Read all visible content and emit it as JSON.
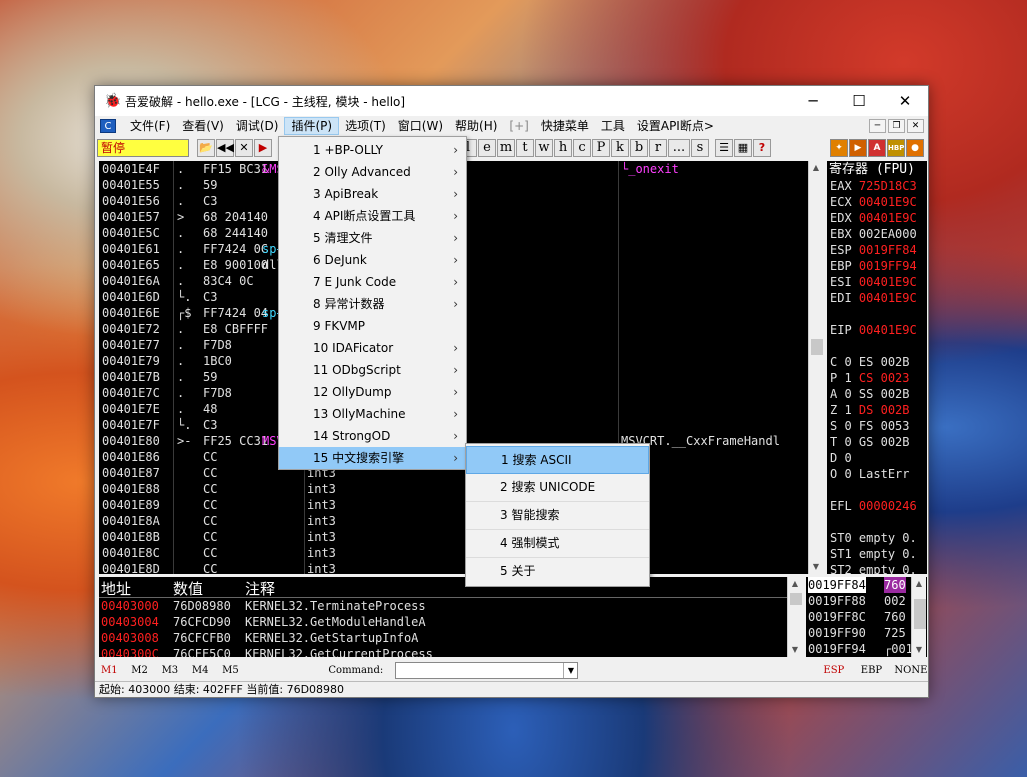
{
  "window": {
    "title": "吾爱破解 - hello.exe - [LCG - 主线程, 模块 - hello]",
    "app_icon": "bug-icon",
    "min": "─",
    "max": "☐",
    "close": "✕"
  },
  "menubar": {
    "items": [
      {
        "label": "文件(F)"
      },
      {
        "label": "查看(V)"
      },
      {
        "label": "调试(D)"
      },
      {
        "label": "插件(P)",
        "active": true
      },
      {
        "label": "选项(T)"
      },
      {
        "label": "窗口(W)"
      },
      {
        "label": "帮助(H)"
      },
      {
        "label": "[+]",
        "dim": true
      },
      {
        "label": "快捷菜单"
      },
      {
        "label": "工具"
      },
      {
        "label": "设置API断点>"
      }
    ]
  },
  "toolbar": {
    "status": "暂停",
    "letters": [
      "l",
      "e",
      "m",
      "t",
      "w",
      "h",
      "c",
      "P",
      "k",
      "b",
      "r",
      "...",
      "s"
    ],
    "right_icons": [
      "bug-icon",
      "run-icon",
      "abp-icon",
      "hbp-icon",
      "bp-icon"
    ]
  },
  "plugin_menu": {
    "items": [
      {
        "label": "1 +BP-OLLY",
        "sub": true
      },
      {
        "label": "2 Olly Advanced",
        "sub": true
      },
      {
        "label": "3 ApiBreak",
        "sub": true
      },
      {
        "label": "4 API断点设置工具",
        "sub": true
      },
      {
        "label": "5 清理文件",
        "sub": true
      },
      {
        "label": "6 DeJunk",
        "sub": true
      },
      {
        "label": "7 E Junk Code",
        "sub": true
      },
      {
        "label": "8 异常计数器",
        "sub": true
      },
      {
        "label": "9 FKVMP",
        "sub": false
      },
      {
        "label": "10 IDAFicator",
        "sub": true
      },
      {
        "label": "11 ODbgScript",
        "sub": true
      },
      {
        "label": "12 OllyDump",
        "sub": true
      },
      {
        "label": "13 OllyMachine",
        "sub": true
      },
      {
        "label": "14 StrongOD",
        "sub": true
      },
      {
        "label": "15 中文搜索引擎",
        "sub": true,
        "highlight": true
      }
    ]
  },
  "search_submenu": {
    "items": [
      {
        "label": "1 搜索 ASCII",
        "highlight": true
      },
      {
        "label": "2 搜索 UNICODE"
      },
      {
        "label": "3 智能搜索"
      },
      {
        "label": "4 强制模式"
      },
      {
        "label": "5 关于"
      }
    ]
  },
  "cpu": {
    "rows": [
      {
        "addr": "00401E4F",
        "mark": ".",
        "hex": "FF15 BC31",
        "dis": "",
        "cmt": "&MSVCRT._onexit>]",
        "cmt2": "└_onexit"
      },
      {
        "addr": "00401E55",
        "mark": ".",
        "hex": "59",
        "dis": "",
        "cmt": ""
      },
      {
        "addr": "00401E56",
        "mark": ".",
        "hex": "C3",
        "dis": "",
        "cmt": ""
      },
      {
        "addr": "00401E57",
        "mark": ">",
        "hex": "68 204140",
        "dis": "",
        "cmt": ""
      },
      {
        "addr": "00401E5C",
        "mark": ".",
        "hex": "68 244140",
        "dis": "",
        "cmt": ""
      },
      {
        "addr": "00401E61",
        "mark": ".",
        "hex": "FF7424 0C",
        "dis": "",
        "cmt": "sp+0xC]"
      },
      {
        "addr": "00401E65",
        "mark": ".",
        "hex": "E8 900100",
        "dis": "",
        "cmt": "dllonexit>"
      },
      {
        "addr": "00401E6A",
        "mark": ".",
        "hex": "83C4 0C",
        "dis": "",
        "cmt": ""
      },
      {
        "addr": "00401E6D",
        "mark": "└.",
        "hex": "C3",
        "dis": "",
        "cmt": ""
      },
      {
        "addr": "00401E6E",
        "mark": "┌$",
        "hex": "FF7424 04",
        "dis": "",
        "cmt": "sp+0x4]"
      },
      {
        "addr": "00401E72",
        "mark": ".",
        "hex": "E8 CBFFFF",
        "dis": "",
        "cmt": ""
      },
      {
        "addr": "00401E77",
        "mark": ".",
        "hex": "F7D8",
        "dis": "",
        "cmt": ""
      },
      {
        "addr": "00401E79",
        "mark": ".",
        "hex": "1BC0",
        "dis": "",
        "cmt": ""
      },
      {
        "addr": "00401E7B",
        "mark": ".",
        "hex": "59",
        "dis": "",
        "cmt": ""
      },
      {
        "addr": "00401E7C",
        "mark": ".",
        "hex": "F7D8",
        "dis": "",
        "cmt": ""
      },
      {
        "addr": "00401E7E",
        "mark": ".",
        "hex": "48",
        "dis": "",
        "cmt": ""
      },
      {
        "addr": "00401E7F",
        "mark": "└.",
        "hex": "C3",
        "dis": "",
        "cmt": ""
      },
      {
        "addr": "00401E80",
        "mark": ">-",
        "hex": "FF25 CC31",
        "dis": "",
        "cmt": "MSVCRT.__CxxFrameHa",
        "cmt2": "MSVCRT.__CxxFrameHandl"
      },
      {
        "addr": "00401E86",
        "mark": "",
        "hex": "CC",
        "dis": "int3",
        "cmt": ""
      },
      {
        "addr": "00401E87",
        "mark": "",
        "hex": "CC",
        "dis": "int3",
        "cmt": ""
      },
      {
        "addr": "00401E88",
        "mark": "",
        "hex": "CC",
        "dis": "int3",
        "cmt": ""
      },
      {
        "addr": "00401E89",
        "mark": "",
        "hex": "CC",
        "dis": "int3",
        "cmt": ""
      },
      {
        "addr": "00401E8A",
        "mark": "",
        "hex": "CC",
        "dis": "int3",
        "cmt": ""
      },
      {
        "addr": "00401E8B",
        "mark": "",
        "hex": "CC",
        "dis": "int3",
        "cmt": ""
      },
      {
        "addr": "00401E8C",
        "mark": "",
        "hex": "CC",
        "dis": "int3",
        "cmt": ""
      },
      {
        "addr": "00401E8D",
        "mark": "",
        "hex": "CC",
        "dis": "int3",
        "cmt": ""
      }
    ]
  },
  "registers": {
    "title": "寄存器 (FPU)",
    "rows": [
      {
        "n": "EAX",
        "v": "725D18C3",
        "red": true
      },
      {
        "n": "ECX",
        "v": "00401E9C",
        "red": true
      },
      {
        "n": "EDX",
        "v": "00401E9C",
        "red": true
      },
      {
        "n": "EBX",
        "v": "002EA000",
        "red": false
      },
      {
        "n": "ESP",
        "v": "0019FF84",
        "red": true
      },
      {
        "n": "EBP",
        "v": "0019FF94",
        "red": true
      },
      {
        "n": "ESI",
        "v": "00401E9C",
        "red": true
      },
      {
        "n": "EDI",
        "v": "00401E9C",
        "red": true
      },
      {
        "n": "",
        "v": "",
        "red": false
      },
      {
        "n": "EIP",
        "v": "00401E9C",
        "red": true
      },
      {
        "n": "",
        "v": "",
        "red": false
      },
      {
        "n": "C 0",
        "v": "ES 002B",
        "red": false
      },
      {
        "n": "P 1",
        "v": "CS 0023",
        "red": true
      },
      {
        "n": "A 0",
        "v": "SS 002B",
        "red": false
      },
      {
        "n": "Z 1",
        "v": "DS 002B",
        "red": true
      },
      {
        "n": "S 0",
        "v": "FS 0053",
        "red": false
      },
      {
        "n": "T 0",
        "v": "GS 002B",
        "red": false
      },
      {
        "n": "D 0",
        "v": "",
        "red": false
      },
      {
        "n": "O 0",
        "v": "LastErr",
        "red": false
      },
      {
        "n": "",
        "v": "",
        "red": false
      },
      {
        "n": "EFL",
        "v": "00000246",
        "red": true
      },
      {
        "n": "",
        "v": "",
        "red": false
      },
      {
        "n": "ST0",
        "v": "empty 0.",
        "red": false
      },
      {
        "n": "ST1",
        "v": "empty 0.",
        "red": false
      },
      {
        "n": "ST2",
        "v": "empty 0.",
        "red": false
      },
      {
        "n": "ST3",
        "v": "empty 0.",
        "red": false
      },
      {
        "n": "ST4",
        "v": "empty 0.",
        "red": false
      }
    ]
  },
  "dump": {
    "headers": [
      "地址",
      "数值",
      "注释"
    ],
    "rows": [
      {
        "addr": "00403000",
        "val": "76D08980",
        "cmt": "KERNEL32.TerminateProcess"
      },
      {
        "addr": "00403004",
        "val": "76CFCD90",
        "cmt": "KERNEL32.GetModuleHandleA"
      },
      {
        "addr": "00403008",
        "val": "76CFCFB0",
        "cmt": "KERNEL32.GetStartupInfoA"
      },
      {
        "addr": "0040300C",
        "val": "76CFF5C0",
        "cmt": "KERNEL32.GetCurrentProcess"
      }
    ]
  },
  "stack": {
    "rows": [
      {
        "addr": "0019FF84",
        "val": "760",
        "sel": true
      },
      {
        "addr": "0019FF88",
        "val": "002"
      },
      {
        "addr": "0019FF8C",
        "val": "760"
      },
      {
        "addr": "0019FF90",
        "val": "725"
      },
      {
        "addr": "0019FF94",
        "val": "┌001"
      }
    ]
  },
  "cmdbar": {
    "m": [
      "M1",
      "M2",
      "M3",
      "M4",
      "M5"
    ],
    "label": "Command:",
    "value": "",
    "esp": "ESP",
    "ebp": "EBP",
    "none": "NONE"
  },
  "statusbar": "起始: 403000 结束: 402FFF 当前值: 76D08980"
}
